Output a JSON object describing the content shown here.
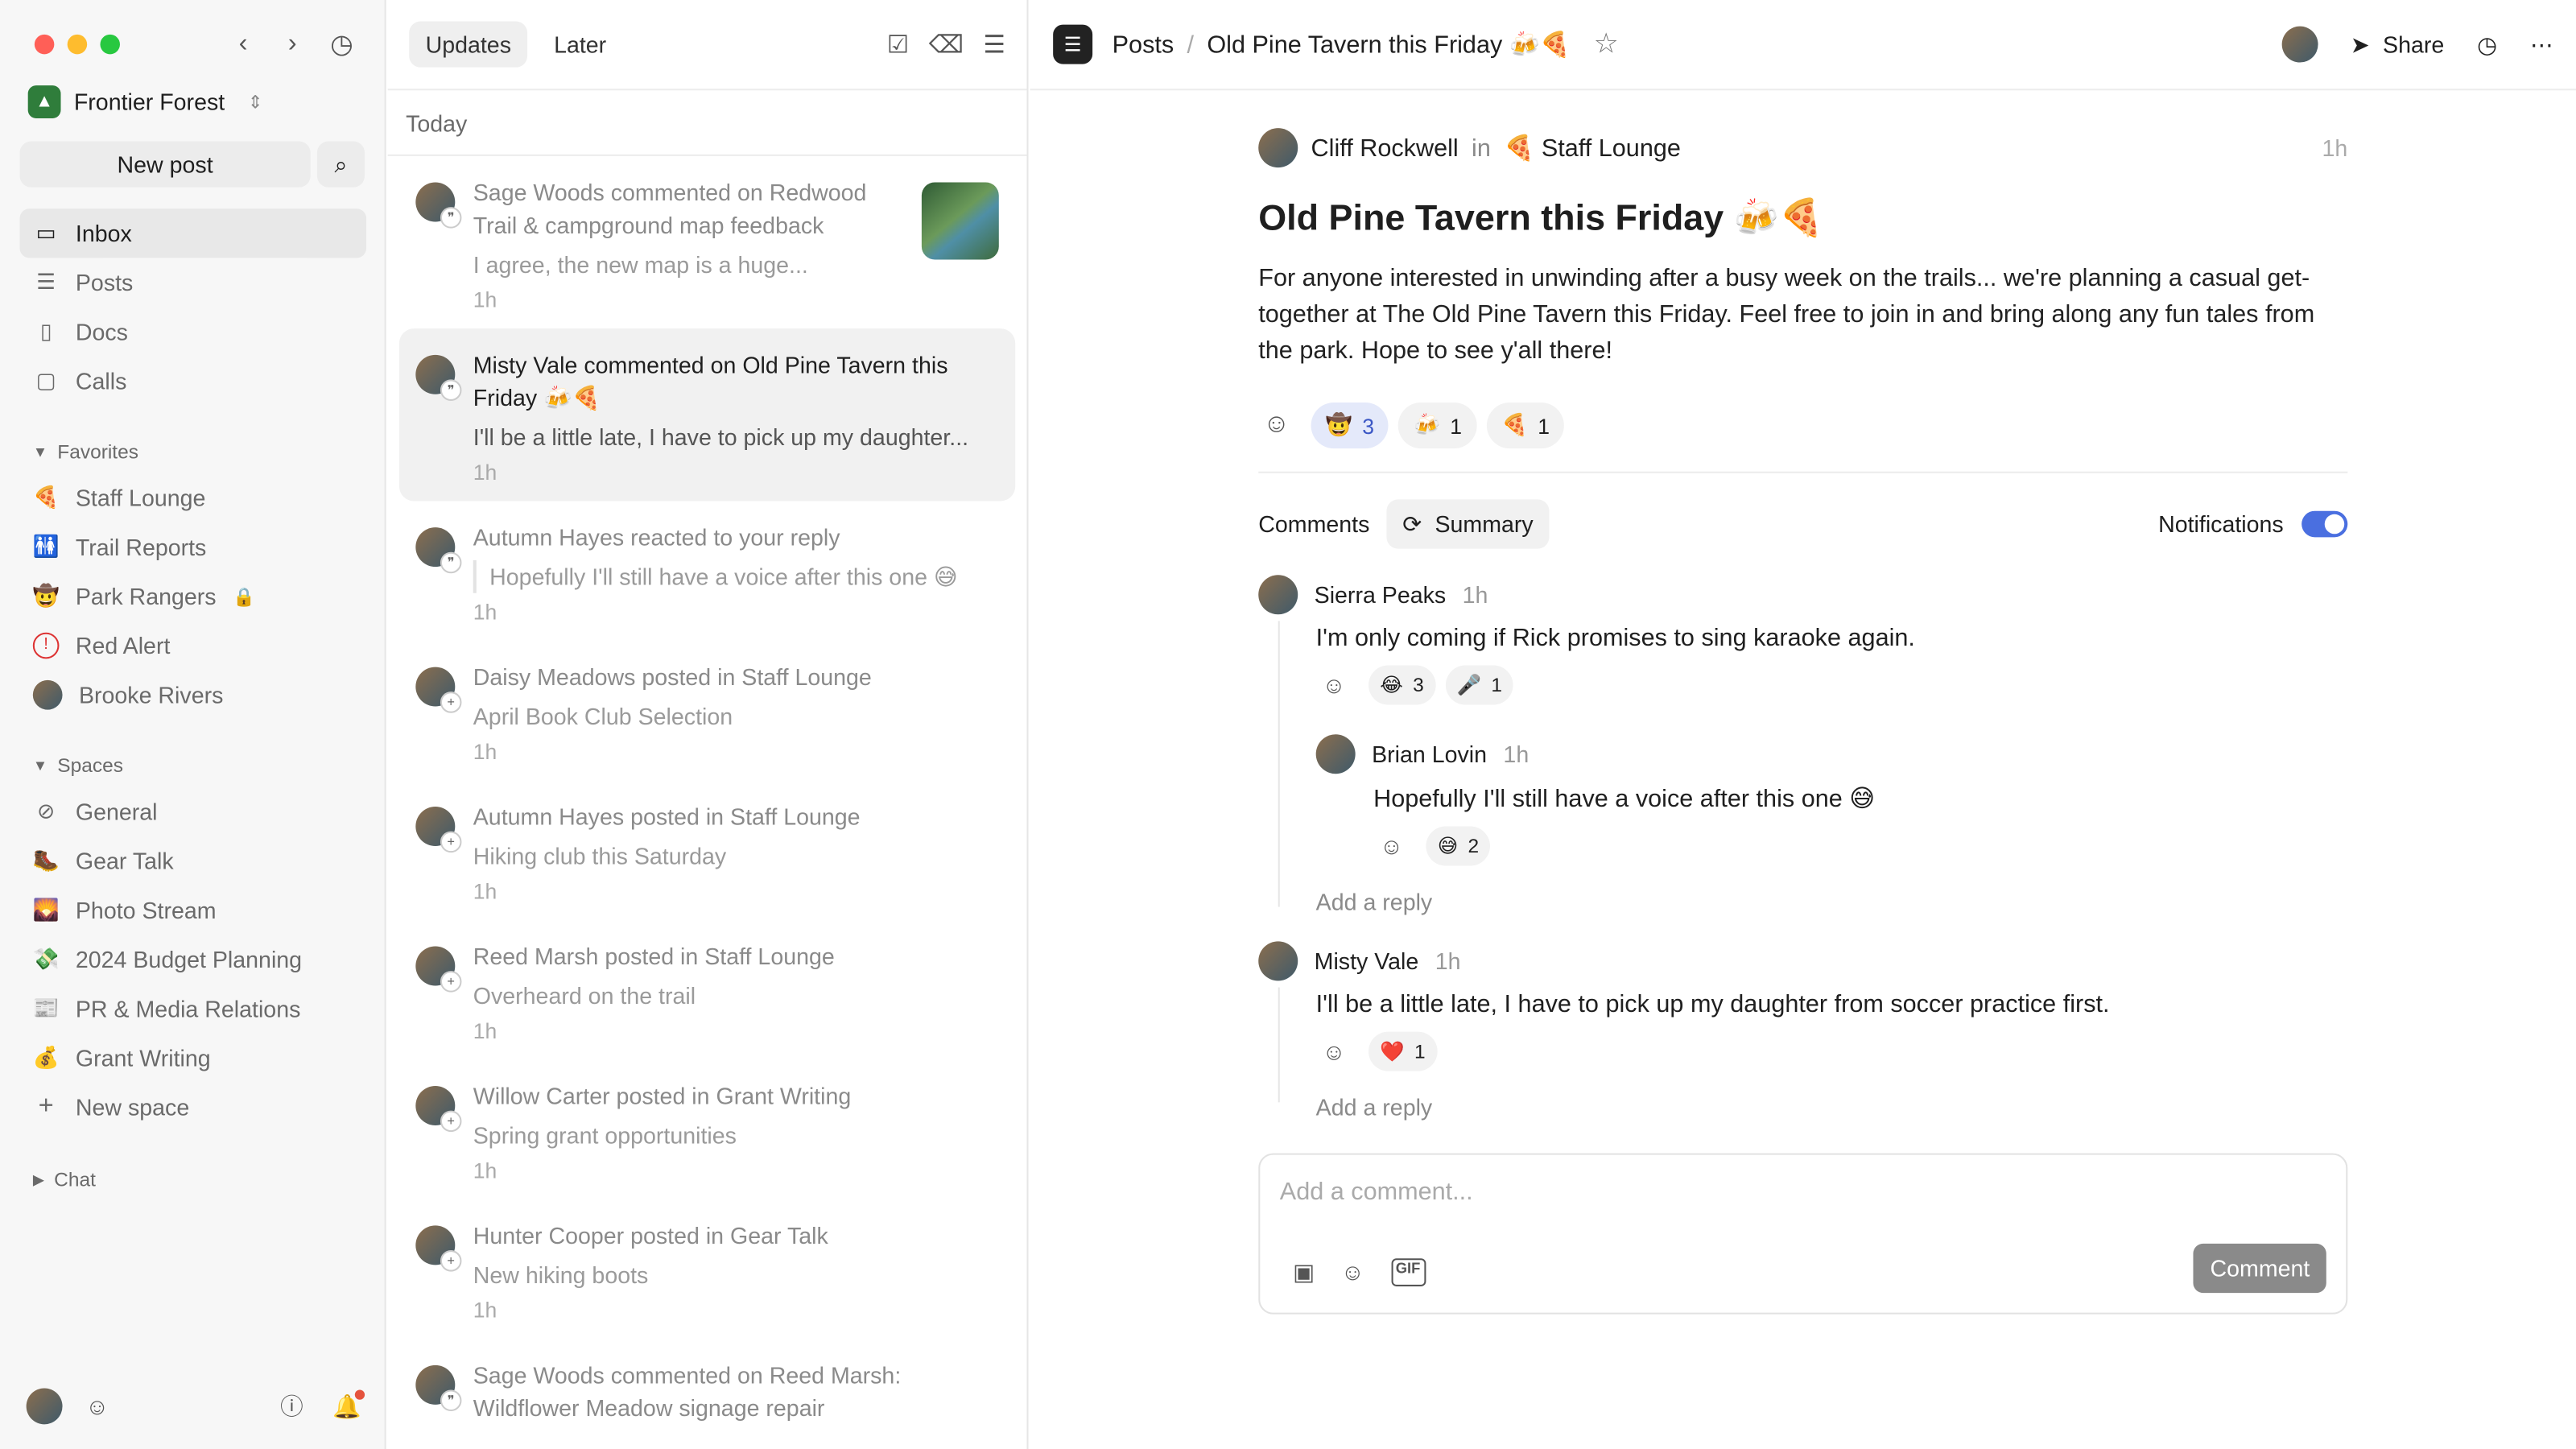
{
  "window": {
    "traffic_colors": [
      "#ff5f57",
      "#febc2e",
      "#28c840"
    ]
  },
  "sidebar": {
    "org_name": "Frontier Forest",
    "new_post": "New post",
    "nav": [
      {
        "label": "Inbox",
        "icon": "inbox-icon"
      },
      {
        "label": "Posts",
        "icon": "posts-icon"
      },
      {
        "label": "Docs",
        "icon": "docs-icon"
      },
      {
        "label": "Calls",
        "icon": "video-icon"
      }
    ],
    "favorites_label": "Favorites",
    "favorites": [
      {
        "label": "Staff Lounge",
        "icon": "🍕"
      },
      {
        "label": "Trail Reports",
        "icon": "🚻"
      },
      {
        "label": "Park Rangers",
        "icon": "🤠"
      },
      {
        "label": "Red Alert",
        "icon": "⓵"
      },
      {
        "label": "Brooke Rivers",
        "icon": "avatar"
      }
    ],
    "spaces_label": "Spaces",
    "spaces": [
      {
        "label": "General",
        "icon": "⊘"
      },
      {
        "label": "Gear Talk",
        "icon": "🥾"
      },
      {
        "label": "Photo Stream",
        "icon": "🌄"
      },
      {
        "label": "2024 Budget Planning",
        "icon": "💸"
      },
      {
        "label": "PR & Media Relations",
        "icon": "📰"
      },
      {
        "label": "Grant Writing",
        "icon": "💰"
      },
      {
        "label": "New space",
        "icon": "+"
      }
    ],
    "chat_label": "Chat"
  },
  "middle": {
    "tabs": [
      "Updates",
      "Later"
    ],
    "today": "Today",
    "items": [
      {
        "actor": "Sage Woods",
        "verb": " commented on ",
        "target": "Redwood Trail & campground map feedback",
        "sub": "I agree, the new map is a huge...",
        "time": "1h"
      },
      {
        "actor": "Misty Vale",
        "verb": " commented on ",
        "target": "Old Pine Tavern this Friday 🍻🍕",
        "sub": "I'll be a little late, I have to pick up my daughter...",
        "time": "1h"
      },
      {
        "actor": "Autumn Hayes",
        "verb": " reacted to your reply",
        "target": "",
        "sub": "Hopefully I'll still have a voice after this one 😅",
        "time": "1h"
      },
      {
        "actor": "Daisy Meadows",
        "verb": " posted in ",
        "target": "Staff Lounge",
        "sub": "April Book Club Selection",
        "time": "1h"
      },
      {
        "actor": "Autumn Hayes",
        "verb": " posted in ",
        "target": "Staff Lounge",
        "sub": "Hiking club this Saturday",
        "time": "1h"
      },
      {
        "actor": "Reed Marsh",
        "verb": " posted in ",
        "target": "Staff Lounge",
        "sub": "Overheard on the trail",
        "time": "1h"
      },
      {
        "actor": "Willow Carter",
        "verb": " posted in ",
        "target": "Grant Writing",
        "sub": "Spring grant opportunities",
        "time": "1h"
      },
      {
        "actor": "Hunter Cooper",
        "verb": " posted in ",
        "target": "Gear Talk",
        "sub": "New hiking boots",
        "time": "1h"
      },
      {
        "actor": "Sage Woods",
        "verb": " commented on ",
        "target": "Reed Marsh: Wildflower Meadow signage repair",
        "sub": "",
        "time": ""
      }
    ]
  },
  "topbar": {
    "crumb_root": "Posts",
    "crumb_sep": "/",
    "crumb_current": "Old Pine Tavern this Friday 🍻🍕",
    "share": "Share"
  },
  "post": {
    "author": "Cliff Rockwell",
    "in": "in",
    "space": "🍕 Staff Lounge",
    "time": "1h",
    "title": "Old Pine Tavern this Friday 🍻🍕",
    "body": "For anyone interested in unwinding after a busy week on the trails... we're planning a casual get-together at The Old Pine Tavern this Friday. Feel free to join in and bring along any fun tales from the park. Hope to see y'all there!",
    "reactions": [
      {
        "emoji": "🤠",
        "count": "3"
      },
      {
        "emoji": "🍻",
        "count": "1"
      },
      {
        "emoji": "🍕",
        "count": "1"
      }
    ]
  },
  "comments": {
    "label": "Comments",
    "summary": "Summary",
    "notifications": "Notifications",
    "list": [
      {
        "author": "Sierra Peaks",
        "time": "1h",
        "body": "I'm only coming if Rick promises to sing karaoke again.",
        "reactions": [
          {
            "emoji": "😂",
            "count": "3"
          },
          {
            "emoji": "🎤",
            "count": "1"
          }
        ]
      },
      {
        "author": "Misty Vale",
        "time": "1h",
        "body": "I'll be a little late, I have to pick up my daughter from soccer practice first.",
        "reactions": [
          {
            "emoji": "❤️",
            "count": "1"
          }
        ]
      }
    ],
    "reply": {
      "author": "Brian Lovin",
      "time": "1h",
      "body": "Hopefully I'll still have a voice after this one 😅",
      "reactions": [
        {
          "emoji": "😅",
          "count": "2"
        }
      ]
    },
    "add_reply": "Add a reply",
    "composer_placeholder": "Add a comment...",
    "composer_button": "Comment",
    "gif": "GIF"
  }
}
